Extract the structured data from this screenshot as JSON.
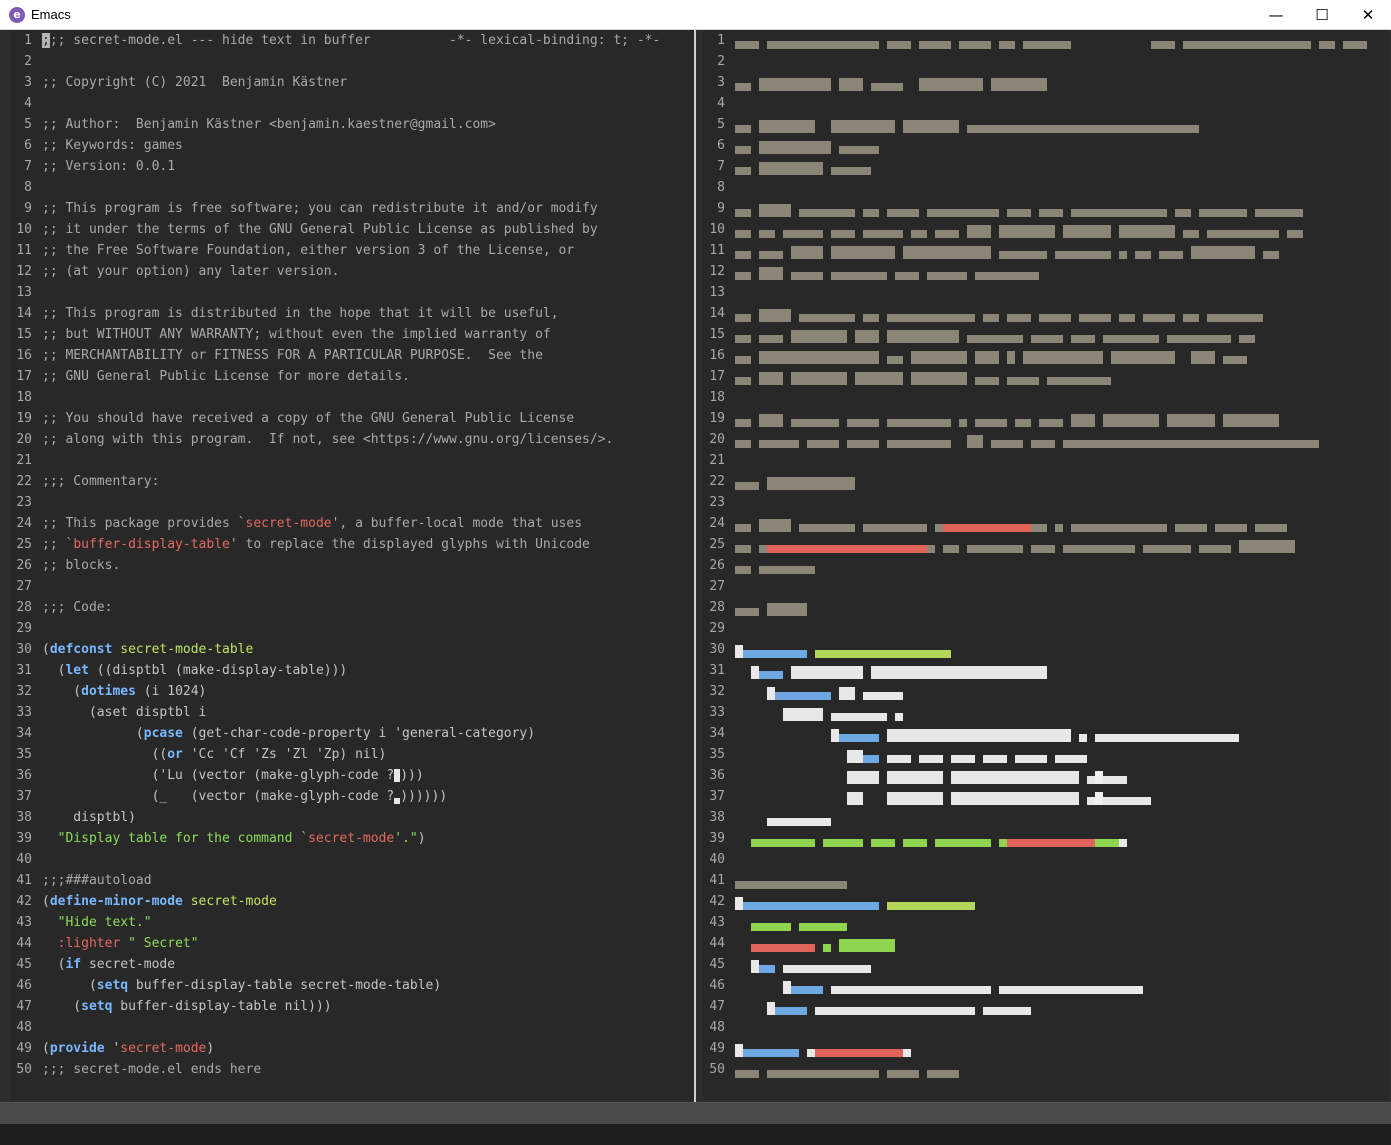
{
  "window": {
    "title": "Emacs",
    "icon_letter": "e",
    "buttons": {
      "minimize": "—",
      "maximize": "☐",
      "close": "✕"
    }
  },
  "colors": {
    "background": "#282828",
    "comment": "#a9a9a9",
    "keyword": "#79b8ff",
    "function": "#c1e35f",
    "string": "#8ddc5a",
    "quoted": "#e5685f",
    "line_number": "#a8a8a8"
  },
  "left_buffer": {
    "file": "secret-mode.el",
    "lines": [
      [
        [
          "cmt",
          ";;; secret-mode.el --- hide text in buffer          -*- lexical-binding: t; -*-"
        ]
      ],
      [],
      [
        [
          "cmt",
          ";; Copyright (C) 2021  Benjamin Kästner"
        ]
      ],
      [],
      [
        [
          "cmt",
          ";; Author:  Benjamin Kästner <benjamin.kaestner@gmail.com>"
        ]
      ],
      [
        [
          "cmt",
          ";; Keywords: games"
        ]
      ],
      [
        [
          "cmt",
          ";; Version: 0.0.1"
        ]
      ],
      [],
      [
        [
          "cmt",
          ";; This program is free software; you can redistribute it and/or modify"
        ]
      ],
      [
        [
          "cmt",
          ";; it under the terms of the GNU General Public License as published by"
        ]
      ],
      [
        [
          "cmt",
          ";; the Free Software Foundation, either version 3 of the License, or"
        ]
      ],
      [
        [
          "cmt",
          ";; (at your option) any later version."
        ]
      ],
      [],
      [
        [
          "cmt",
          ";; This program is distributed in the hope that it will be useful,"
        ]
      ],
      [
        [
          "cmt",
          ";; but WITHOUT ANY WARRANTY; without even the implied warranty of"
        ]
      ],
      [
        [
          "cmt",
          ";; MERCHANTABILITY or FITNESS FOR A PARTICULAR PURPOSE.  See the"
        ]
      ],
      [
        [
          "cmt",
          ";; GNU General Public License for more details."
        ]
      ],
      [],
      [
        [
          "cmt",
          ";; You should have received a copy of the GNU General Public License"
        ]
      ],
      [
        [
          "cmt",
          ";; along with this program.  If not, see <https://www.gnu.org/licenses/>."
        ]
      ],
      [],
      [
        [
          "cmt",
          ";;; Commentary:"
        ]
      ],
      [],
      [
        [
          "cmt",
          ";; This package provides `"
        ],
        [
          "q",
          "secret-mode"
        ],
        [
          "cmt",
          "', a buffer-local mode that uses"
        ]
      ],
      [
        [
          "cmt",
          ";; `"
        ],
        [
          "q",
          "buffer-display-table"
        ],
        [
          "cmt",
          "' to replace the displayed glyphs with Unicode"
        ]
      ],
      [
        [
          "cmt",
          ";; blocks."
        ]
      ],
      [],
      [
        [
          "cmt",
          ";;; Code:"
        ]
      ],
      [],
      [
        [
          "txt",
          "("
        ],
        [
          "kw",
          "defconst"
        ],
        [
          "txt",
          " "
        ],
        [
          "fn",
          "secret-mode-table"
        ]
      ],
      [
        [
          "txt",
          "  ("
        ],
        [
          "kw",
          "let"
        ],
        [
          "txt",
          " ((disptbl (make-display-table)))"
        ]
      ],
      [
        [
          "txt",
          "    ("
        ],
        [
          "kw",
          "dotimes"
        ],
        [
          "txt",
          " (i 1024)"
        ]
      ],
      [
        [
          "txt",
          "      (aset disptbl i"
        ]
      ],
      [
        [
          "txt",
          "            ("
        ],
        [
          "kw",
          "pcase"
        ],
        [
          "txt",
          " (get-char-code-property i 'general-category)"
        ]
      ],
      [
        [
          "txt",
          "              (("
        ],
        [
          "kw",
          "or"
        ],
        [
          "txt",
          " 'Cc 'Cf 'Zs 'Zl 'Zp) nil)"
        ]
      ],
      [
        [
          "txt",
          "              ('Lu (vector (make-glyph-code ?"
        ],
        [
          "glyph",
          "█"
        ],
        [
          "txt",
          ")))"
        ]
      ],
      [
        [
          "txt",
          "              (_   (vector (make-glyph-code ?"
        ],
        [
          "low",
          "▄"
        ],
        [
          "txt",
          "))))))"
        ]
      ],
      [
        [
          "txt",
          "    disptbl)"
        ]
      ],
      [
        [
          "str",
          "  \"Display table for the command `"
        ],
        [
          "q",
          "secret-mode"
        ],
        [
          "str",
          "'.\""
        ],
        [
          "txt",
          ")"
        ]
      ],
      [],
      [
        [
          "cmt",
          ";;;###autoload"
        ]
      ],
      [
        [
          "txt",
          "("
        ],
        [
          "kw",
          "define-minor-mode"
        ],
        [
          "txt",
          " "
        ],
        [
          "fn",
          "secret-mode"
        ]
      ],
      [
        [
          "str",
          "  \"Hide text.\""
        ]
      ],
      [
        [
          "txt",
          "  "
        ],
        [
          "q",
          ":lighter"
        ],
        [
          "txt",
          " "
        ],
        [
          "str",
          "\" Secret\""
        ]
      ],
      [
        [
          "txt",
          "  ("
        ],
        [
          "kw",
          "if"
        ],
        [
          "txt",
          " secret-mode"
        ]
      ],
      [
        [
          "txt",
          "      ("
        ],
        [
          "kw",
          "setq"
        ],
        [
          "txt",
          " buffer-display-table secret-mode-table)"
        ]
      ],
      [
        [
          "txt",
          "    ("
        ],
        [
          "kw",
          "setq"
        ],
        [
          "txt",
          " buffer-display-table nil)))"
        ]
      ],
      [],
      [
        [
          "txt",
          "("
        ],
        [
          "kw",
          "provide"
        ],
        [
          "txt",
          " '"
        ],
        [
          "q",
          "secret-mode"
        ],
        [
          "txt",
          ")"
        ]
      ],
      [
        [
          "cmt",
          ";;; secret-mode.el ends here"
        ]
      ]
    ]
  },
  "right_buffer": {
    "line_numbers": [
      "1",
      "2",
      "3",
      "4",
      "5",
      "6",
      "7",
      "8",
      "9",
      "10",
      "11",
      "12",
      "13",
      "14",
      "15",
      "16",
      "17",
      "18",
      "19",
      "20",
      "21",
      "22",
      "23",
      "24",
      "25",
      "26",
      "27",
      "28",
      "29",
      "30",
      "31",
      "32",
      "33",
      "34",
      "35",
      "36",
      "37",
      "38",
      "39",
      "40",
      "41",
      "42",
      "43",
      "44",
      "45",
      "46",
      "47",
      "48",
      "49",
      "50"
    ]
  }
}
